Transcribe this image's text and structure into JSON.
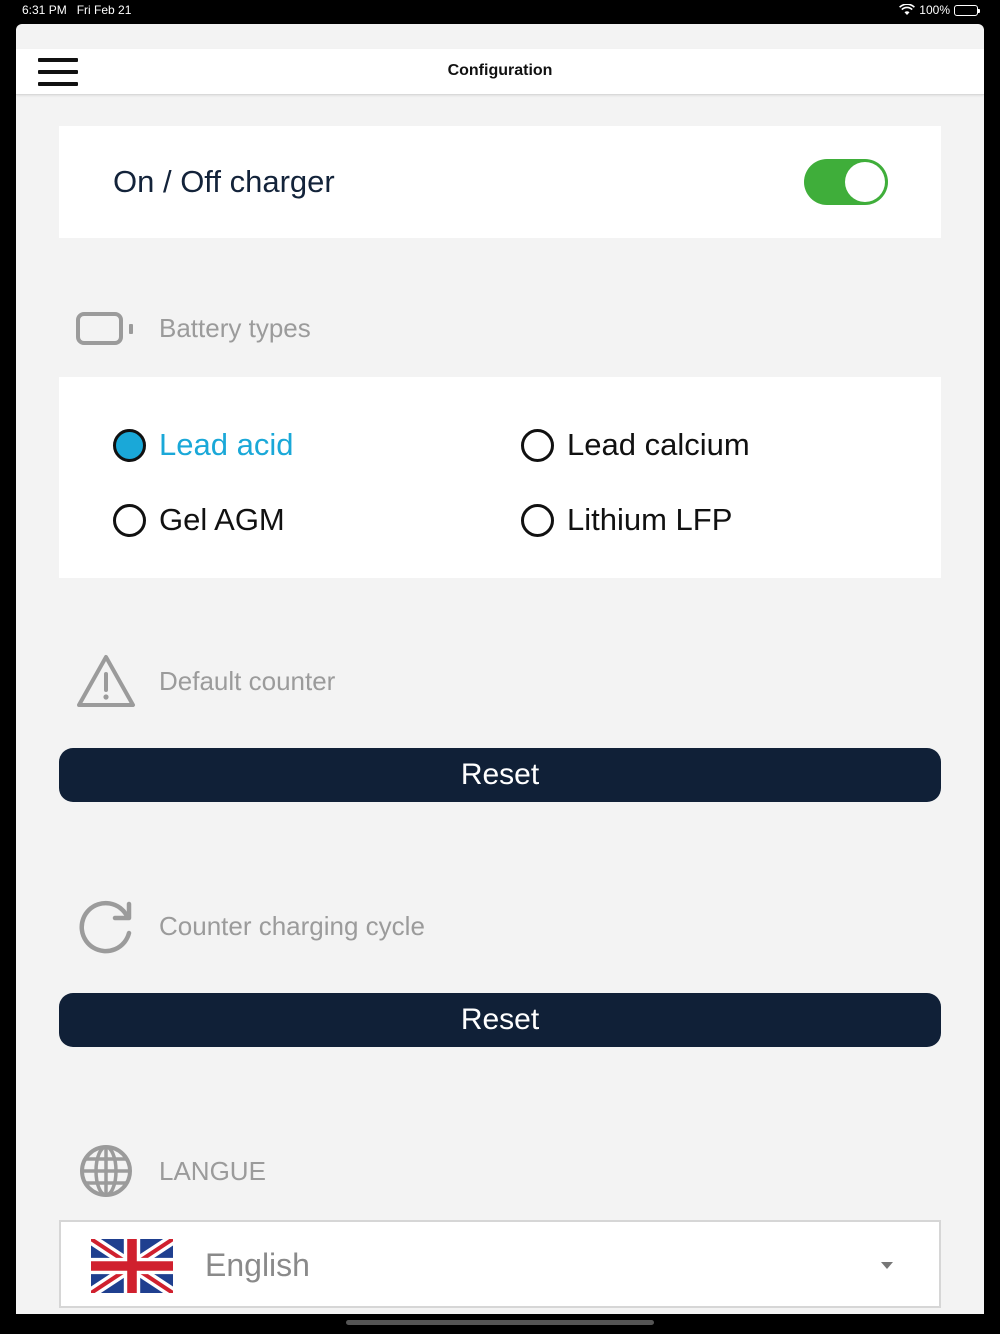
{
  "status_bar": {
    "time": "6:31 PM",
    "date": "Fri Feb 21",
    "battery": "100%"
  },
  "header": {
    "title": "Configuration",
    "menu_icon": "hamburger-icon"
  },
  "charger": {
    "label": "On / Off charger",
    "enabled": true,
    "toggle_color": "#3fae3a"
  },
  "battery_types": {
    "title": "Battery types",
    "icon": "battery-icon",
    "options": [
      {
        "label": "Lead acid",
        "selected": true
      },
      {
        "label": "Lead calcium",
        "selected": false
      },
      {
        "label": "Gel AGM",
        "selected": false
      },
      {
        "label": "Lithium LFP",
        "selected": false
      }
    ],
    "accent": "#1aa8d8"
  },
  "default_counter": {
    "title": "Default counter",
    "icon": "warning-icon",
    "button": "Reset"
  },
  "charging_cycle": {
    "title": "Counter charging cycle",
    "icon": "refresh-icon",
    "button": "Reset"
  },
  "language": {
    "title": "LANGUE",
    "icon": "globe-icon",
    "selected": "English",
    "flag": "uk-flag-icon"
  },
  "colors": {
    "button_bg": "#102037",
    "background": "#f3f3f3"
  }
}
